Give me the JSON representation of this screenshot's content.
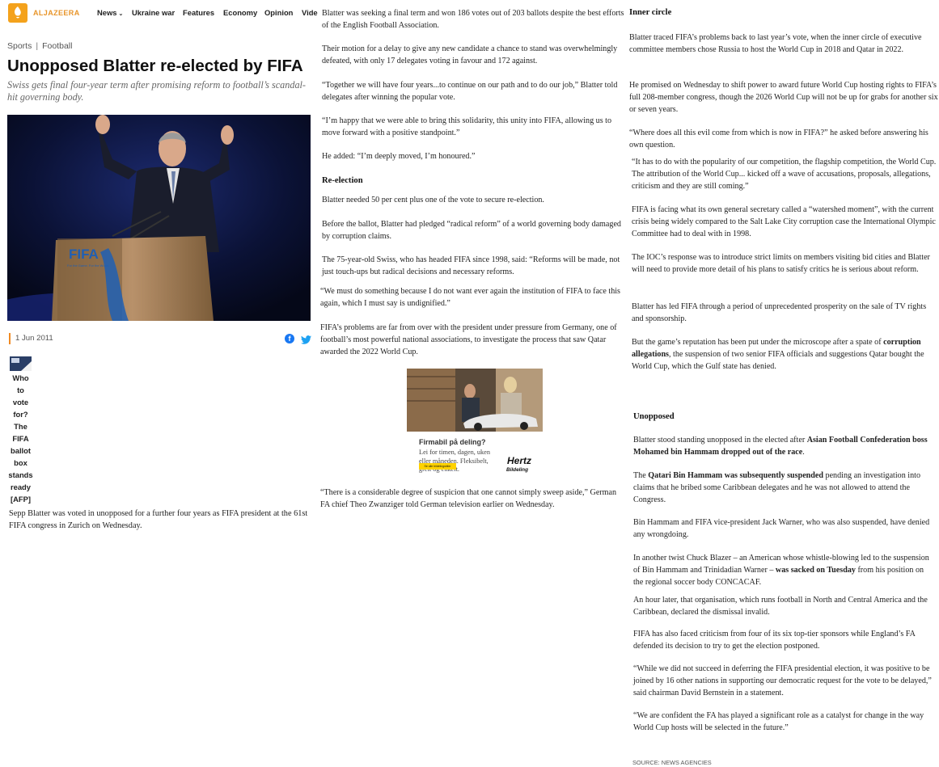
{
  "nav": {
    "logo": "ALJAZEERA",
    "items": [
      "News",
      "Ukraine war",
      "Features",
      "Economy",
      "Opinion",
      "Vide"
    ]
  },
  "article": {
    "breadcrumb": [
      "Sports",
      "Football"
    ],
    "headline": "Unopposed Blatter re-elected by FIFA",
    "subhead": "Swiss gets final four-year term after promising reform to football’s scandal-hit governing body.",
    "date": "1 Jun 2011",
    "caption": "Who to vote for? The FIFA ballot box stands ready [AFP]",
    "caption_lines": [
      "Who",
      "to",
      "vote",
      "for?",
      "The",
      "FIFA",
      "ballot",
      "box",
      "stands",
      "ready",
      "[AFP]"
    ],
    "lede": "Sepp Blatter was voted in unopposed for a further four years as FIFA president at the 61st FIFA congress in Zurich on Wednesday.",
    "hero_sign": "FIFA",
    "hero_slogan": "For the Game. For the World."
  },
  "col2": {
    "p1": "Blatter was seeking a final term and won 186 votes out of 203 ballots despite the best efforts of the English Football Association.",
    "p2": "Their motion for a delay to give any new candidate a chance to stand was overwhelmingly defeated, with only 17 delegates voting in favour and 172 against.",
    "p3": "“Together we will have four years...to continue on our path and to do our job,” Blatter told delegates after winning the popular vote.",
    "p4": "“I’m happy that we were able to bring this solidarity, this unity into FIFA, allowing us to move forward with a positive standpoint.”",
    "p5": "He added: “I’m deeply moved, I’m honoured.”",
    "h1": "Re-election",
    "p6": "Blatter needed 50 per cent plus one of the vote to secure re-election.",
    "p7": "Before the ballot, Blatter had pledged “radical reform” of a world governing body damaged by corruption claims.",
    "p8": "The 75-year-old Swiss, who has headed FIFA since 1998, said: “Reforms will be made, not just touch-ups but radical decisions and necessary reforms.",
    "p9": "“We must do something because I do not want ever again the institution of FIFA to face this again, which I must say is undignified.”",
    "p10": "FIFA’s problems are far from over with the president under pressure from Germany, one of football’s most powerful national associations, to investigate the process that saw Qatar awarded the 2022 World Cup.",
    "p11": "“There is a considerable degree of suspicion that one cannot simply sweep aside,” German FA chief Theo Zwanziger told German television earlier on Wednesday."
  },
  "ad": {
    "title": "Firmabil på deling?",
    "body": "Lei for timen, dagen, uken eller måneden. Fleksibelt, greit og enkelt.",
    "brand": "Hertz",
    "brand_sub": "Bildeling",
    "button": "Se alle bildelingsbiler"
  },
  "col3": {
    "h1": "Inner circle",
    "p1": "Blatter traced FIFA’s problems back to last year’s vote, when the inner circle of executive committee members chose Russia to host the World Cup in 2018 and Qatar in 2022.",
    "p2": "He promised on Wednesday to shift power to award future World Cup hosting rights to FIFA’s full 208-member congress, though the 2026 World Cup will not be up for grabs for another six or seven years.",
    "p3": "“Where does all this evil come from which is now in FIFA?” he asked before answering his own question.",
    "p4": "“It has to do with the popularity of our competition, the flagship competition, the World Cup. The attribution of the World Cup... kicked off a wave of accusations, proposals, allegations, criticism and they are still coming.”",
    "p5": "FIFA is facing what its own general secretary called a “watershed moment”, with the current crisis being widely compared to the Salt Lake City corruption case the International Olympic Committee had to deal with in 1998.",
    "p6": "The IOC’s response was to introduce strict limits on members visiting bid cities and Blatter will need to provide more detail of his plans to satisfy critics he is serious about reform.",
    "p7": "Blatter has led FIFA through a period of unprecedented prosperity on the sale of TV rights and sponsorship.",
    "p8a": "But the game’s reputation has been put under the microscope after a spate of ",
    "p8b": "corruption allegations",
    "p8c": ", the suspension of two senior FIFA officials and suggestions Qatar bought the World Cup, which the Gulf state has denied.",
    "h2": "Unopposed",
    "p9a": "Blatter stood standing unopposed in the elected after ",
    "p9b": "Asian Football Confederation boss Mohamed bin Hammam dropped out of the race",
    "p9c": ".",
    "p10a": "The ",
    "p10b": "Qatari Bin Hammam was subsequently suspended",
    "p10c": " pending an investigation into claims that he bribed some Caribbean delegates and he was not allowed to attend the Congress.",
    "p11": "Bin Hammam and FIFA vice-president Jack Warner, who was also suspended, have denied any wrongdoing.",
    "p12a": "In another twist Chuck Blazer – an American whose whistle-blowing led to the suspension of Bin Hammam and Trinidadian Warner – ",
    "p12b": "was sacked on Tuesday",
    "p12c": " from his position on the regional soccer body CONCACAF.",
    "p13": "An hour later, that organisation, which runs football in North and Central America and the Caribbean, declared the dismissal invalid.",
    "p14": "FIFA has also faced criticism from four of its six top-tier sponsors while England’s FA defended its decision to try to get the election postponed.",
    "p15": "“While we did not succeed in deferring the FIFA presidential election, it was positive to be joined by 16 other nations in supporting our democratic request for the vote to be delayed,” said chairman David Bernstein in a statement.",
    "p16": "“We are confident the FA has played a significant role as a catalyst for change in the way World Cup hosts will be selected in the future.”",
    "source": "SOURCE: NEWS AGENCIES"
  },
  "colors": {
    "accent": "#f08a24",
    "logo": "#f4a21c",
    "facebook": "#1877f2",
    "twitter": "#1da1f2"
  }
}
